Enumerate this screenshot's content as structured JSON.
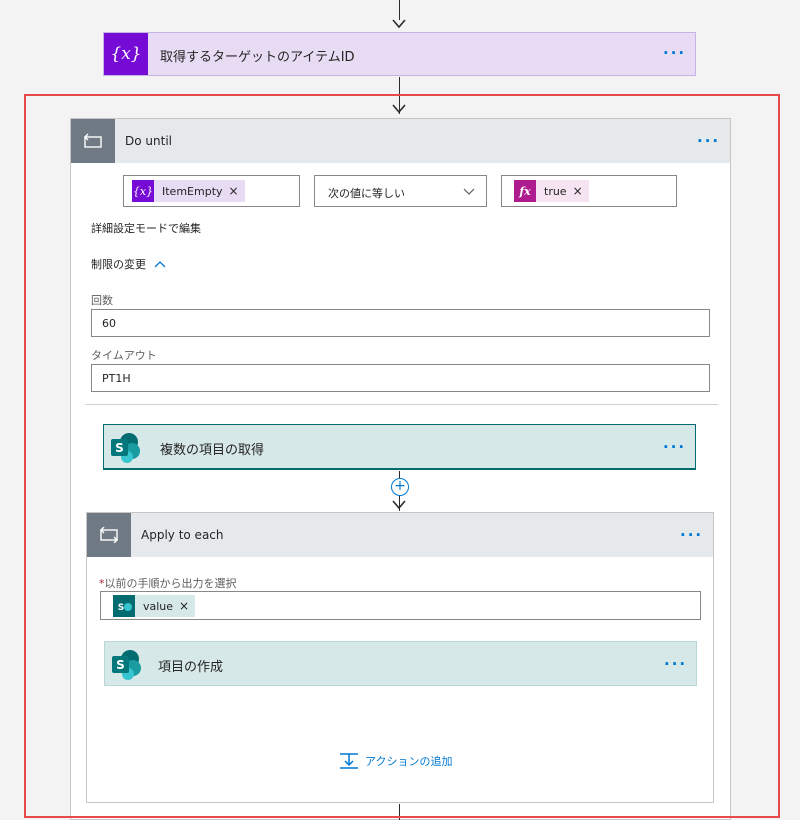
{
  "variable_action": {
    "title": "取得するターゲットのアイテムID",
    "icon": "variable-icon",
    "color": "#770bd6",
    "header_bg": "#e8dcf5"
  },
  "do_until": {
    "title": "Do until",
    "icon": "loop-icon",
    "condition": {
      "left_token": "ItemEmpty",
      "operator": "次の値に等しい",
      "right_token": "true"
    },
    "advanced_mode_link": "詳細設定モードで編集",
    "change_limits_label": "制限の変更",
    "count_label": "回数",
    "count_value": "60",
    "timeout_label": "タイムアウト",
    "timeout_value": "PT1H"
  },
  "get_items": {
    "title": "複数の項目の取得",
    "icon": "sharepoint-icon",
    "color": "#036c70"
  },
  "apply_to_each": {
    "title": "Apply to each",
    "icon": "loop-icon",
    "required_marker": "*",
    "select_label": "以前の手順から出力を選択",
    "token": "value"
  },
  "create_item": {
    "title": "項目の作成",
    "icon": "sharepoint-icon"
  },
  "add_action_label": "アクションの追加",
  "highlight_color": "#e8494b"
}
